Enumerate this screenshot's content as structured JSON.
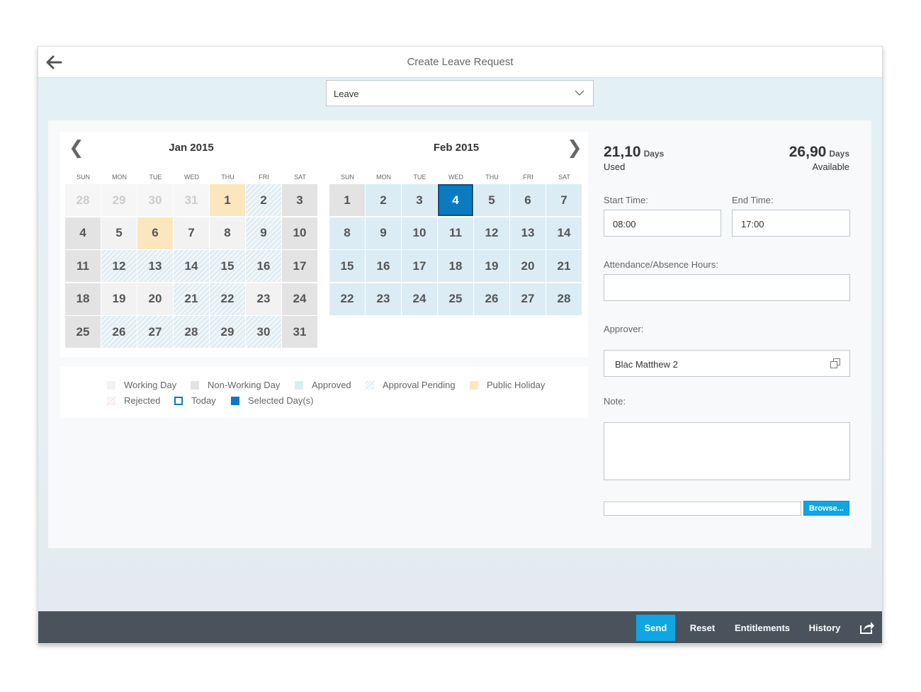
{
  "header": {
    "title": "Create Leave Request",
    "back_icon": "arrow-left-icon"
  },
  "leave_type": {
    "value": "Leave",
    "icon": "chevron-down-icon"
  },
  "calendar": {
    "prev_icon": "chevron-left-icon",
    "next_icon": "chevron-right-icon",
    "days_of_week": [
      "SUN",
      "MON",
      "TUE",
      "WED",
      "THU",
      "FRI",
      "SAT"
    ],
    "months": [
      {
        "title": "Jan 2015",
        "weeks": [
          [
            {
              "d": "28",
              "s": "other"
            },
            {
              "d": "29",
              "s": "other"
            },
            {
              "d": "30",
              "s": "other"
            },
            {
              "d": "31",
              "s": "other"
            },
            {
              "d": "1",
              "s": "holiday"
            },
            {
              "d": "2",
              "s": "pending"
            },
            {
              "d": "3",
              "s": "nonworking"
            }
          ],
          [
            {
              "d": "4",
              "s": "nonworking"
            },
            {
              "d": "5",
              "s": "working"
            },
            {
              "d": "6",
              "s": "holiday"
            },
            {
              "d": "7",
              "s": "working"
            },
            {
              "d": "8",
              "s": "working"
            },
            {
              "d": "9",
              "s": "pending"
            },
            {
              "d": "10",
              "s": "nonworking"
            }
          ],
          [
            {
              "d": "11",
              "s": "nonworking"
            },
            {
              "d": "12",
              "s": "pending"
            },
            {
              "d": "13",
              "s": "pending"
            },
            {
              "d": "14",
              "s": "pending"
            },
            {
              "d": "15",
              "s": "pending"
            },
            {
              "d": "16",
              "s": "pending"
            },
            {
              "d": "17",
              "s": "nonworking"
            }
          ],
          [
            {
              "d": "18",
              "s": "nonworking"
            },
            {
              "d": "19",
              "s": "working"
            },
            {
              "d": "20",
              "s": "working"
            },
            {
              "d": "21",
              "s": "pending"
            },
            {
              "d": "22",
              "s": "pending"
            },
            {
              "d": "23",
              "s": "working"
            },
            {
              "d": "24",
              "s": "nonworking"
            }
          ],
          [
            {
              "d": "25",
              "s": "nonworking"
            },
            {
              "d": "26",
              "s": "pending"
            },
            {
              "d": "27",
              "s": "pending"
            },
            {
              "d": "28",
              "s": "pending"
            },
            {
              "d": "29",
              "s": "pending"
            },
            {
              "d": "30",
              "s": "pending"
            },
            {
              "d": "31",
              "s": "nonworking"
            }
          ]
        ]
      },
      {
        "title": "Feb 2015",
        "weeks": [
          [
            {
              "d": "1",
              "s": "nonworking"
            },
            {
              "d": "2",
              "s": "approved"
            },
            {
              "d": "3",
              "s": "approved"
            },
            {
              "d": "4",
              "s": "selected"
            },
            {
              "d": "5",
              "s": "approved"
            },
            {
              "d": "6",
              "s": "approved"
            },
            {
              "d": "7",
              "s": "approved"
            }
          ],
          [
            {
              "d": "8",
              "s": "approved"
            },
            {
              "d": "9",
              "s": "approved"
            },
            {
              "d": "10",
              "s": "approved"
            },
            {
              "d": "11",
              "s": "approved"
            },
            {
              "d": "12",
              "s": "approved"
            },
            {
              "d": "13",
              "s": "approved"
            },
            {
              "d": "14",
              "s": "approved"
            }
          ],
          [
            {
              "d": "15",
              "s": "approved"
            },
            {
              "d": "16",
              "s": "approved"
            },
            {
              "d": "17",
              "s": "approved"
            },
            {
              "d": "18",
              "s": "approved"
            },
            {
              "d": "19",
              "s": "approved"
            },
            {
              "d": "20",
              "s": "approved"
            },
            {
              "d": "21",
              "s": "approved"
            }
          ],
          [
            {
              "d": "22",
              "s": "approved"
            },
            {
              "d": "23",
              "s": "approved"
            },
            {
              "d": "24",
              "s": "approved"
            },
            {
              "d": "25",
              "s": "approved"
            },
            {
              "d": "26",
              "s": "approved"
            },
            {
              "d": "27",
              "s": "approved"
            },
            {
              "d": "28",
              "s": "approved"
            }
          ]
        ]
      }
    ]
  },
  "legend": {
    "working": "Working Day",
    "nonworking": "Non-Working Day",
    "approved": "Approved",
    "pending": "Approval Pending",
    "holiday": "Public Holiday",
    "rejected": "Rejected",
    "today": "Today",
    "selected": "Selected Day(s)"
  },
  "form": {
    "used": {
      "value": "21,10",
      "unit": "Days",
      "label": "Used"
    },
    "available": {
      "value": "26,90",
      "unit": "Days",
      "label": "Available"
    },
    "start_time": {
      "label": "Start Time:",
      "value": "08:00"
    },
    "end_time": {
      "label": "End Time:",
      "value": "17:00"
    },
    "hours": {
      "label": "Attendance/Absence Hours:",
      "value": ""
    },
    "approver": {
      "label": "Approver:",
      "value": "Blac Matthew 2",
      "icon": "value-help-icon"
    },
    "note": {
      "label": "Note:",
      "value": ""
    },
    "attachment": {
      "value": "",
      "browse_label": "Browse..."
    }
  },
  "footer": {
    "send": "Send",
    "reset": "Reset",
    "entitlements": "Entitlements",
    "history": "History",
    "share_icon": "share-icon"
  },
  "colors": {
    "accent": "#0fa6e3",
    "selected": "#0a7bbf",
    "footer_bg": "#4a535b",
    "holiday": "#fbe6be",
    "approved": "#dcecf4"
  }
}
